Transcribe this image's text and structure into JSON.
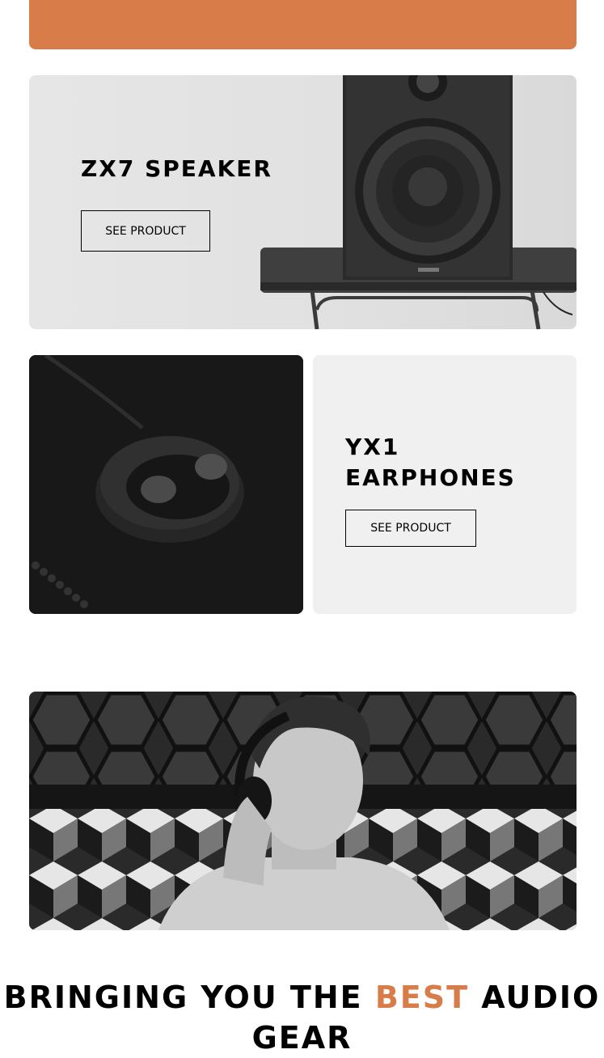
{
  "colors": {
    "accent": "#D87D4A"
  },
  "speaker": {
    "title": "ZX7 SPEAKER",
    "button": "SEE PRODUCT"
  },
  "earphones": {
    "title_line1": "YX1",
    "title_line2": "EARPHONES",
    "button": "SEE PRODUCT"
  },
  "about": {
    "heading_part1": "BRINGING YOU THE ",
    "heading_accent": "BEST",
    "heading_part2": " AUDIO GEAR"
  }
}
